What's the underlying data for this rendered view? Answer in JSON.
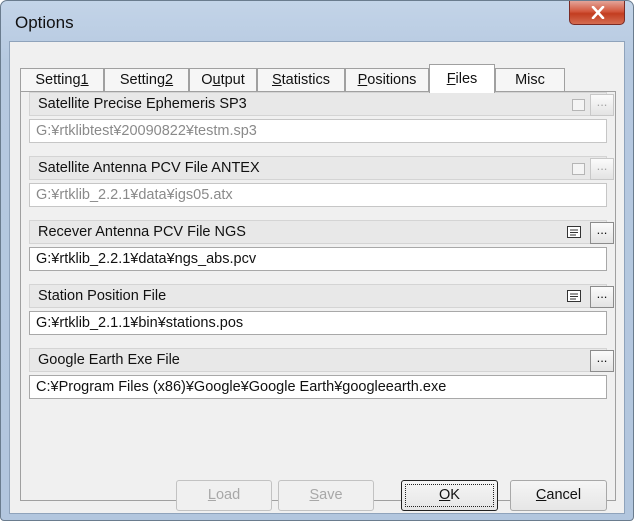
{
  "window": {
    "title": "Options",
    "close_icon": "close-icon"
  },
  "tabs": [
    {
      "label": "Setting1",
      "active": false
    },
    {
      "label": "Setting2",
      "active": false
    },
    {
      "label": "Output",
      "active": false
    },
    {
      "label": "Statistics",
      "active": false
    },
    {
      "label": "Positions",
      "active": false
    },
    {
      "label": "Files",
      "active": true
    },
    {
      "label": "Misc",
      "active": false
    }
  ],
  "files": [
    {
      "label": "Satellite Precise Ephemeris SP3",
      "path": "G:¥rtklibtest¥20090822¥testm.sp3",
      "enabled": false,
      "has_checkbox": true,
      "has_view": false,
      "browse": "..."
    },
    {
      "label": "Satellite Antenna PCV File ANTEX",
      "path": "G:¥rtklib_2.2.1¥data¥igs05.atx",
      "enabled": false,
      "has_checkbox": true,
      "has_view": false,
      "browse": "..."
    },
    {
      "label": "Recever Antenna PCV File NGS",
      "path": "G:¥rtklib_2.2.1¥data¥ngs_abs.pcv",
      "enabled": true,
      "has_checkbox": false,
      "has_view": true,
      "browse": "..."
    },
    {
      "label": "Station Position File",
      "path": "G:¥rtklib_2.1.1¥bin¥stations.pos",
      "enabled": true,
      "has_checkbox": false,
      "has_view": true,
      "browse": "..."
    },
    {
      "label": "Google Earth Exe File",
      "path": "C:¥Program Files (x86)¥Google¥Google Earth¥googleearth.exe",
      "enabled": true,
      "has_checkbox": false,
      "has_view": false,
      "browse": "..."
    }
  ],
  "buttons": {
    "load": "Load",
    "save": "Save",
    "ok": "OK",
    "cancel": "Cancel"
  }
}
